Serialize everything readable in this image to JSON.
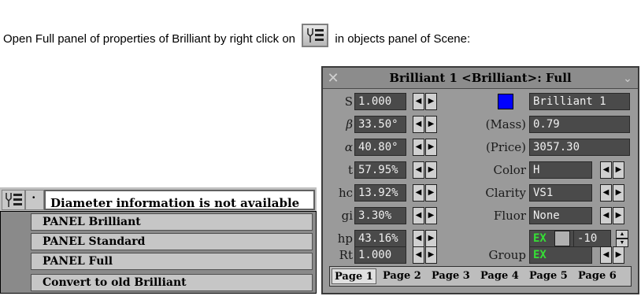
{
  "intro": {
    "before": "Open Full panel of properties of Brilliant by right click on",
    "after": "in objects panel of Scene:",
    "icon": "tool-list-icon"
  },
  "context_menu": {
    "info_text": "Diameter information is not available",
    "items": [
      "PANEL Brilliant",
      "PANEL Standard",
      "PANEL Full",
      "Convert to old Brilliant"
    ]
  },
  "panel": {
    "title": "Brilliant 1 <Brilliant>: Full",
    "left_rows": [
      {
        "label": "S",
        "value": "1.000"
      },
      {
        "label": "β",
        "value": "33.50°"
      },
      {
        "label": "α",
        "value": "40.80°"
      },
      {
        "label": "t",
        "value": "57.95%"
      },
      {
        "label": "hc",
        "value": "13.92%"
      },
      {
        "label": "gi",
        "value": "3.30%"
      },
      {
        "label": "hp",
        "value": "43.16%"
      },
      {
        "label": "Rt",
        "value": "1.000"
      }
    ],
    "right": {
      "name_value": "Brilliant 1",
      "mass_label": "(Mass)",
      "mass_value": "0.79",
      "price_label": "(Price)",
      "price_value": "3057.30",
      "color_label": "Color",
      "color_value": "H",
      "clarity_label": "Clarity",
      "clarity_value": "VS1",
      "fluor_label": "Fluor",
      "fluor_value": "None",
      "ex_value": "EX",
      "ex_number": "-10",
      "group_label": "Group",
      "group_value": "EX"
    },
    "tabs": [
      "Page 1",
      "Page 2",
      "Page 3",
      "Page 4",
      "Page 5",
      "Page 6"
    ],
    "active_tab": "Page 1",
    "swatch_color": "#0000ff"
  }
}
